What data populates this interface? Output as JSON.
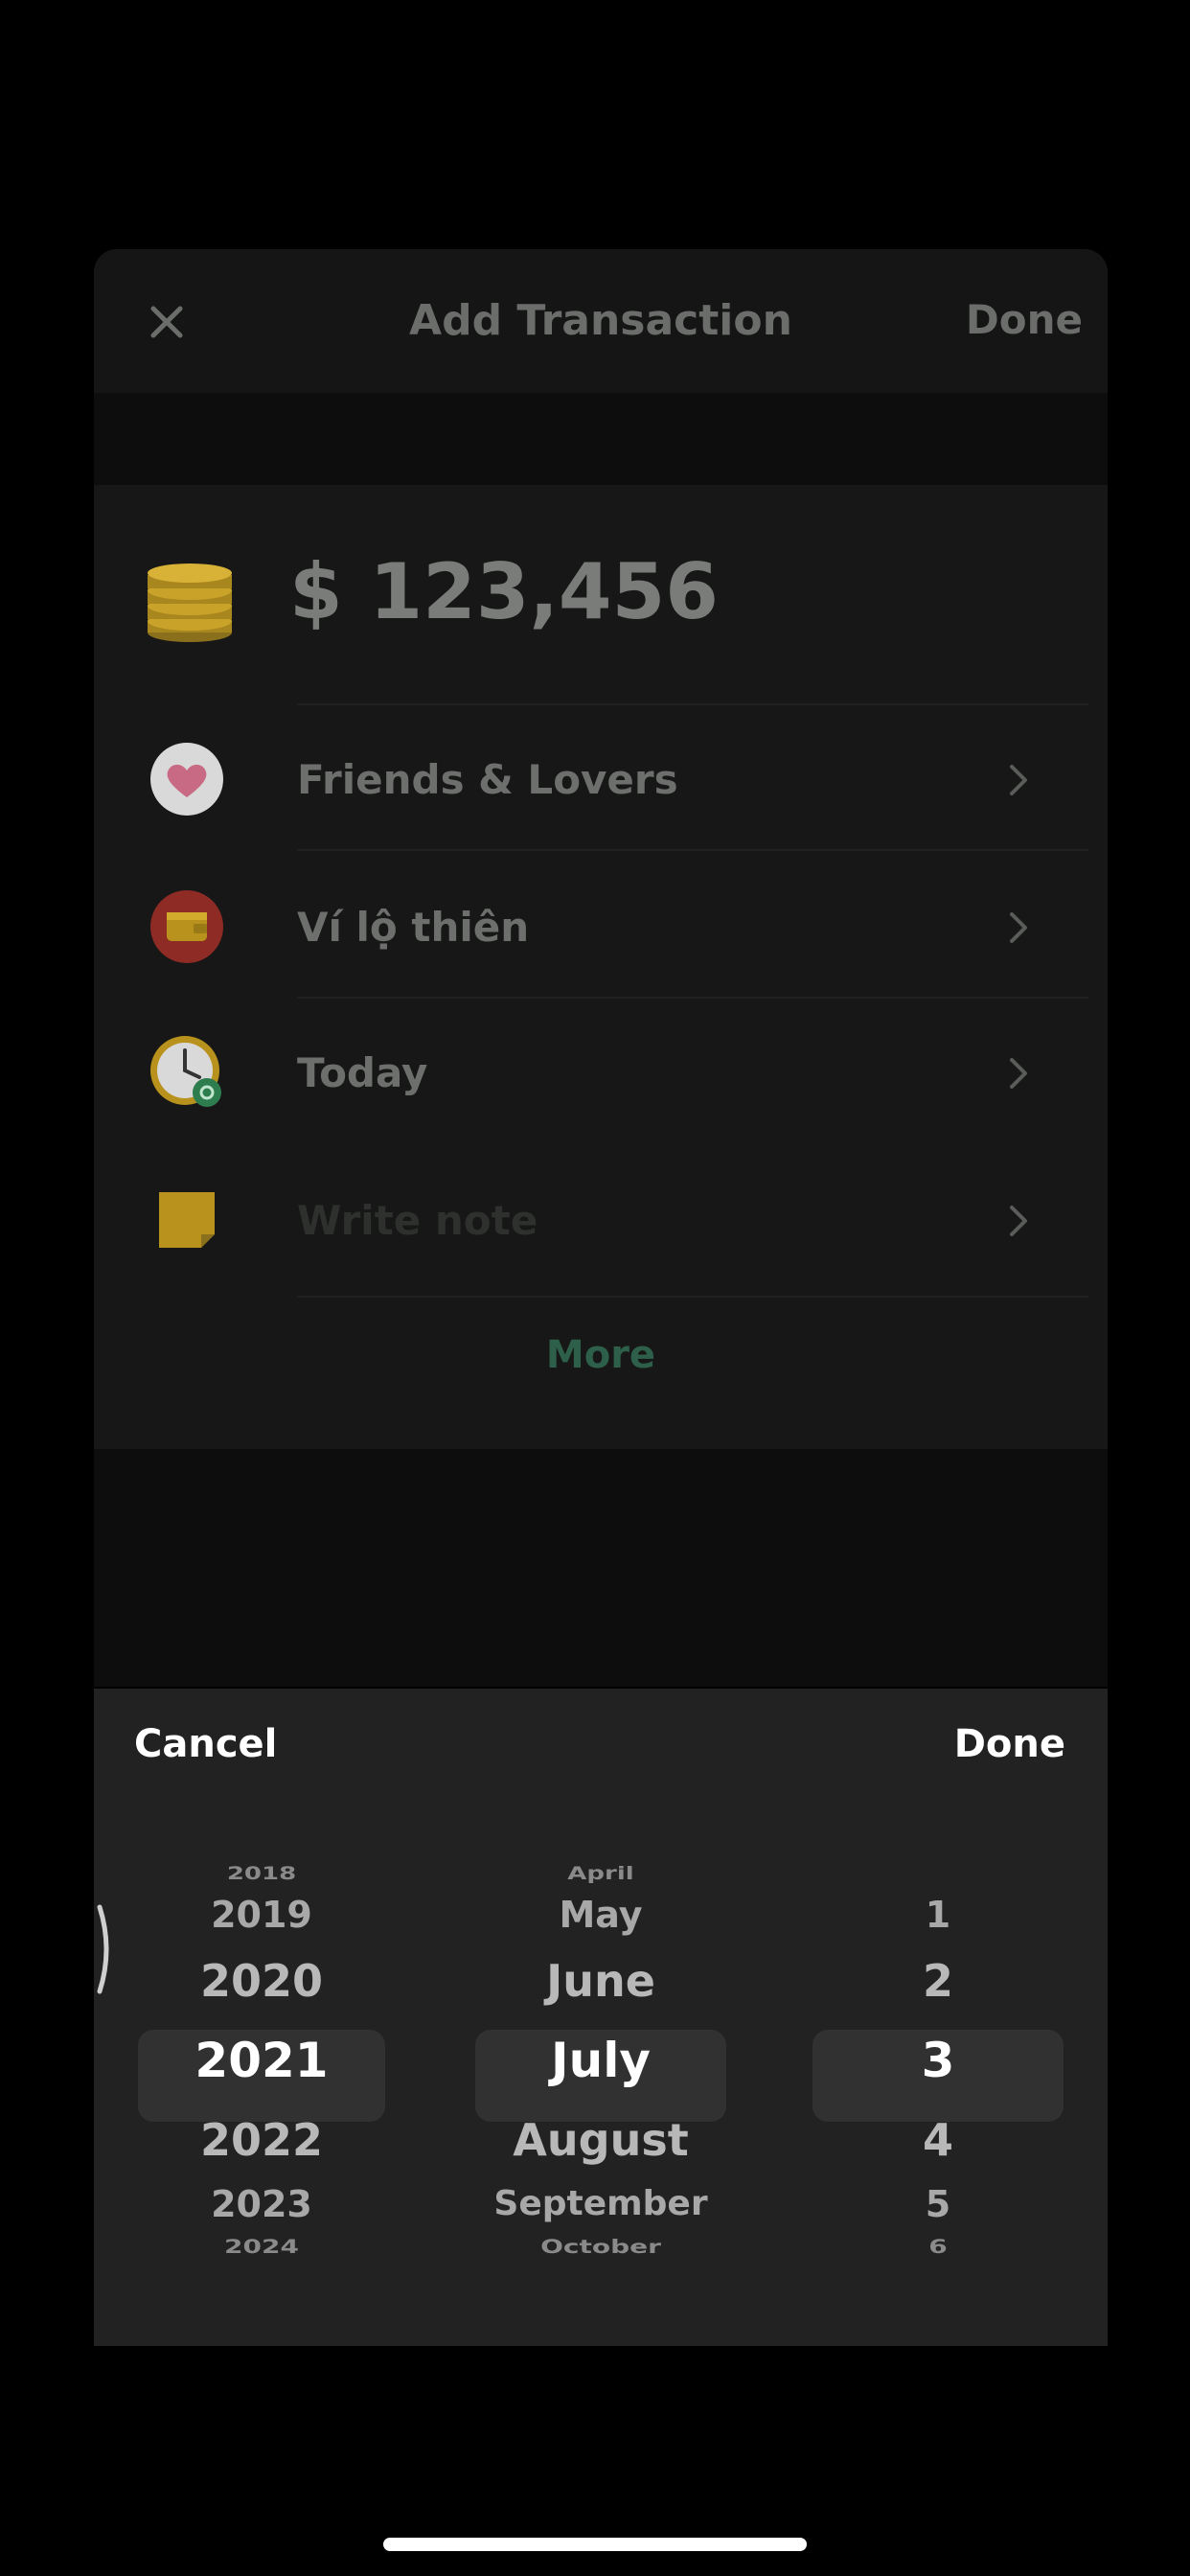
{
  "header": {
    "title": "Add Transaction",
    "done_label": "Done",
    "close_icon": "close-icon"
  },
  "amount": {
    "value": "$ 123,456",
    "icon": "coins-icon"
  },
  "rows": [
    {
      "label": "Friends & Lovers",
      "icon": "heart-icon",
      "placeholder": false
    },
    {
      "label": "Ví lộ thiên",
      "icon": "wallet-icon",
      "placeholder": false
    },
    {
      "label": "Today",
      "icon": "clock-icon",
      "placeholder": false
    },
    {
      "label": "Write note",
      "icon": "note-icon",
      "placeholder": true
    }
  ],
  "more_label": "More",
  "picker": {
    "cancel_label": "Cancel",
    "done_label": "Done",
    "years": [
      "2018",
      "2019",
      "2020",
      "2021",
      "2022",
      "2023",
      "2024"
    ],
    "months": [
      "April",
      "May",
      "June",
      "July",
      "August",
      "September",
      "October"
    ],
    "days": [
      "1",
      "2",
      "3",
      "4",
      "5",
      "6"
    ],
    "selected": {
      "year": "2021",
      "month": "July",
      "day": "3"
    }
  },
  "colors": {
    "accent_more": "#2d5f4b",
    "background": "#000000",
    "picker_bg": "#212221"
  }
}
